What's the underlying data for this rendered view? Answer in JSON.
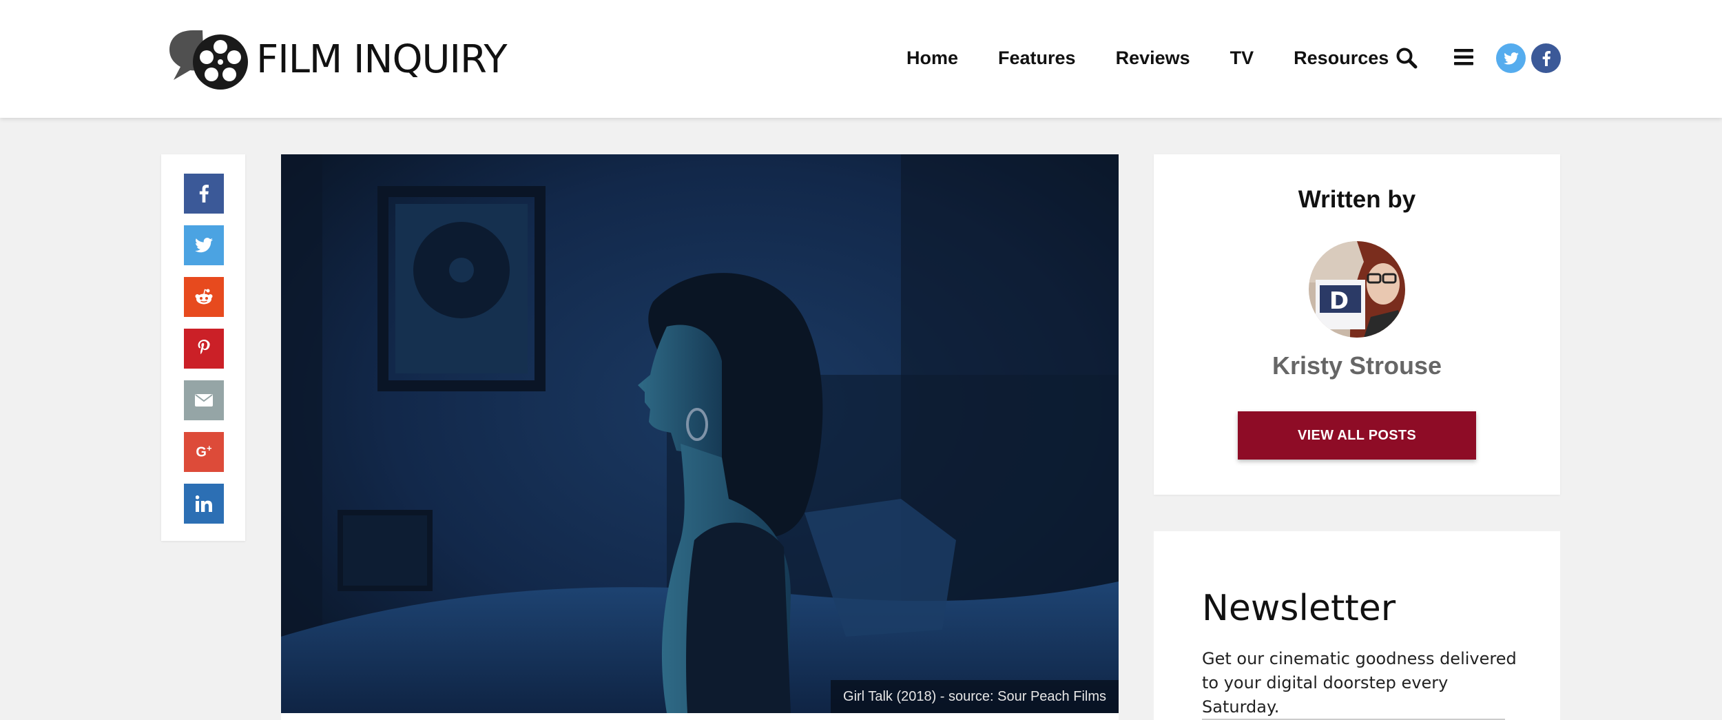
{
  "brand": {
    "name": "FILM INQUIRY"
  },
  "nav": {
    "items": [
      "Home",
      "Features",
      "Reviews",
      "TV",
      "Resources"
    ],
    "icons": [
      "search-icon",
      "menu-icon",
      "twitter-icon",
      "facebook-icon"
    ]
  },
  "share": {
    "buttons": [
      {
        "name": "facebook",
        "color": "#3b5998"
      },
      {
        "name": "twitter",
        "color": "#4ba3e2"
      },
      {
        "name": "reddit",
        "color": "#e74a1e"
      },
      {
        "name": "pinterest",
        "color": "#cb2027"
      },
      {
        "name": "email",
        "color": "#95a5a6"
      },
      {
        "name": "google-plus",
        "color": "#dd4b39"
      },
      {
        "name": "linkedin",
        "color": "#2c6fb4"
      }
    ]
  },
  "hero": {
    "caption": "Girl Talk (2018) - source: Sour Peach Films"
  },
  "author": {
    "heading": "Written by",
    "name": "Kristy Strouse",
    "button_label": "VIEW ALL POSTS",
    "button_color": "#8e0c26"
  },
  "newsletter": {
    "title": "Newsletter",
    "description": "Get our cinematic goodness delivered to your digital doorstep every Saturday."
  },
  "colors": {
    "background": "#f1f1f1",
    "accent": "#8e0c26"
  }
}
